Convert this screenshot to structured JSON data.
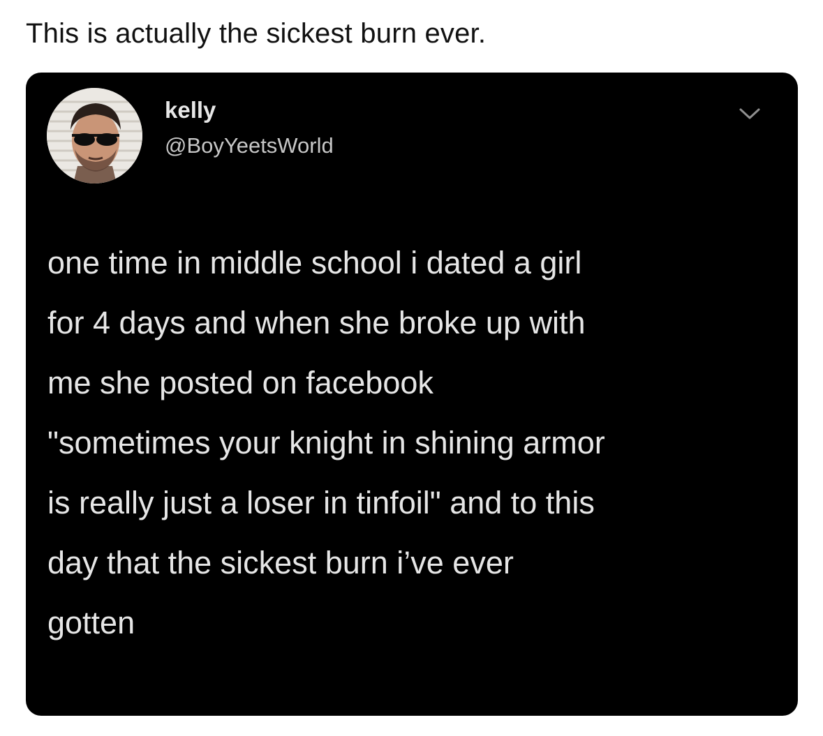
{
  "post": {
    "caption": "This is actually the sickest burn ever."
  },
  "tweet": {
    "display_name": "kelly",
    "handle": "@BoyYeetsWorld",
    "avatar_icon": "profile-photo-man-sunglasses",
    "menu_icon": "chevron-down-icon",
    "lines": [
      "one time in middle school i dated a girl",
      "for 4 days and when she broke up with",
      "me she posted on facebook",
      "\"sometimes your knight in shining armor",
      "is really just a loser in tinfoil\" and to this",
      "day that the sickest burn i’ve ever",
      "gotten"
    ]
  },
  "colors": {
    "page_background": "#ffffff",
    "card_background": "#000000",
    "tweet_text": "#e6e6e6",
    "handle_text": "#c7c7c7"
  }
}
